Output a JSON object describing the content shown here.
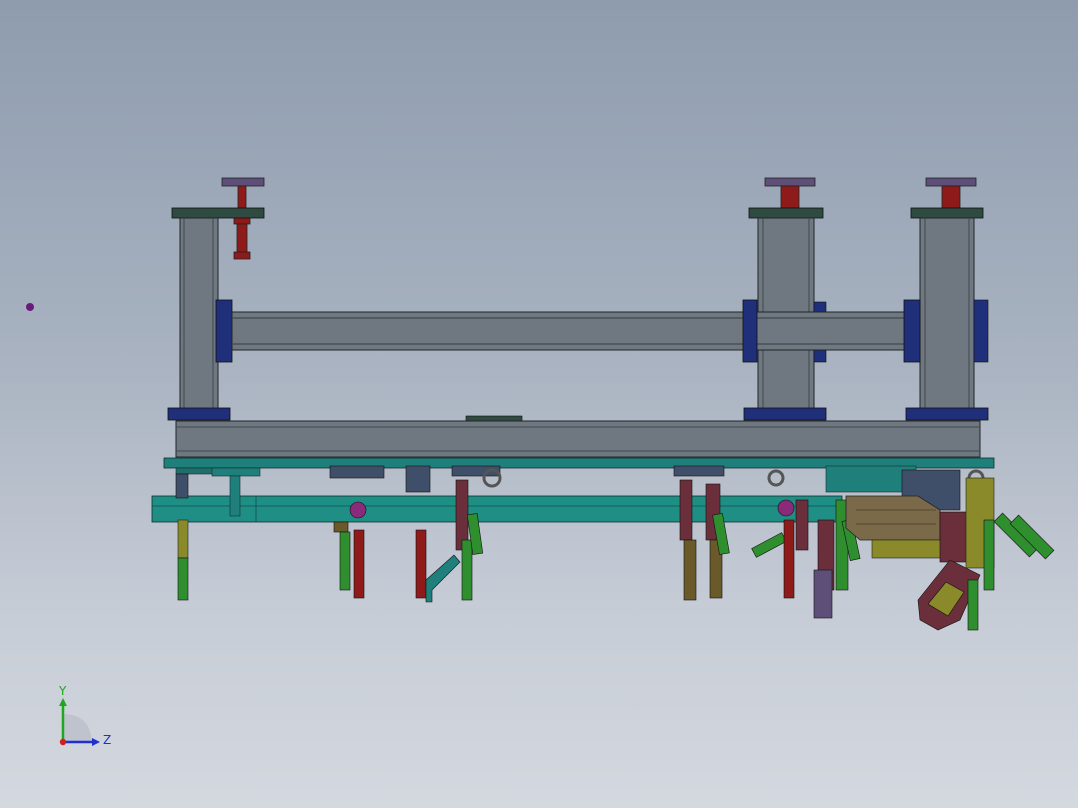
{
  "viewport": {
    "background_top": "#8e9cae",
    "background_bottom": "#d4d8df"
  },
  "model": {
    "colors": {
      "frame": "#6f7880",
      "frame_dark": "#3f474d",
      "plate_dark": "#2f4a40",
      "bracket_blue": "#1f2f7a",
      "cap_purple": "#5d4f78",
      "cylinder_red": "#8e1a1a",
      "base_teal": "#1f7f7a",
      "clamp_green": "#2f8f2f",
      "clamp_olive": "#8a8a2a",
      "clamp_maroon": "#6a2f3a",
      "clamp_magenta": "#8a2a7a",
      "wood": "#7a6a4a"
    }
  },
  "triad": {
    "y_label": "Y",
    "z_label": "Z",
    "y_color": "#1fa81f",
    "z_color": "#1f2fd0",
    "x_color": "#d01f1f"
  }
}
